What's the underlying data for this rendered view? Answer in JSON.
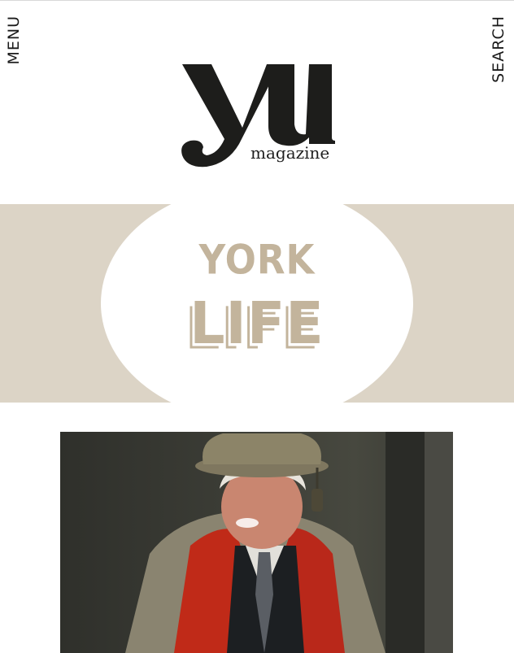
{
  "nav": {
    "menu_label": "MENU",
    "search_label": "SEARCH"
  },
  "logo": {
    "letters": "yu",
    "word": "magazine"
  },
  "section": {
    "line1": "YORK",
    "line2": "LIFE"
  },
  "colors": {
    "band": "#dcd4c6",
    "section_text": "#c3b49c",
    "ink": "#1b1b1b",
    "gown_red": "#c02a18"
  },
  "photo": {
    "subject": "graduation-gown-photo"
  }
}
